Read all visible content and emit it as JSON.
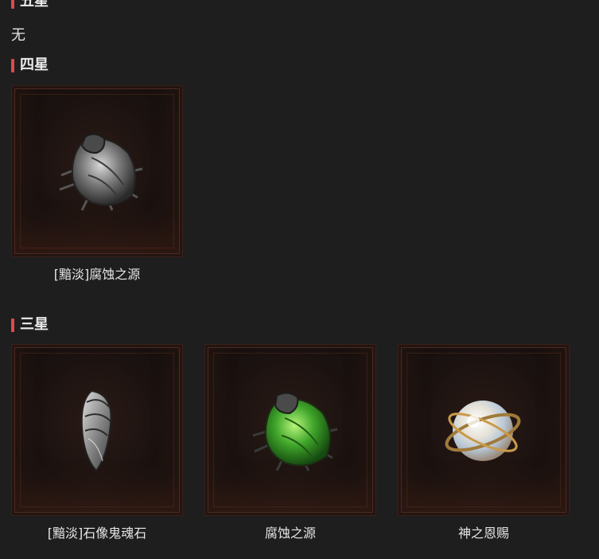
{
  "sections": {
    "five_star": {
      "title": "五星",
      "empty_text": "无"
    },
    "four_star": {
      "title": "四星",
      "items": [
        {
          "name": "[黯淡]腐蚀之源",
          "icon": "dim-corrosion-source-icon"
        }
      ]
    },
    "three_star": {
      "title": "三星",
      "items": [
        {
          "name": "[黯淡]石像鬼魂石",
          "icon": "dim-gargoyle-soulstone-icon"
        },
        {
          "name": "腐蚀之源",
          "icon": "corrosion-source-icon"
        },
        {
          "name": "神之恩赐",
          "icon": "gods-gift-orb-icon"
        }
      ]
    }
  },
  "colors": {
    "accent": "#e04a4a",
    "background": "#1e1e1f",
    "frame_border": "#3a2017"
  }
}
